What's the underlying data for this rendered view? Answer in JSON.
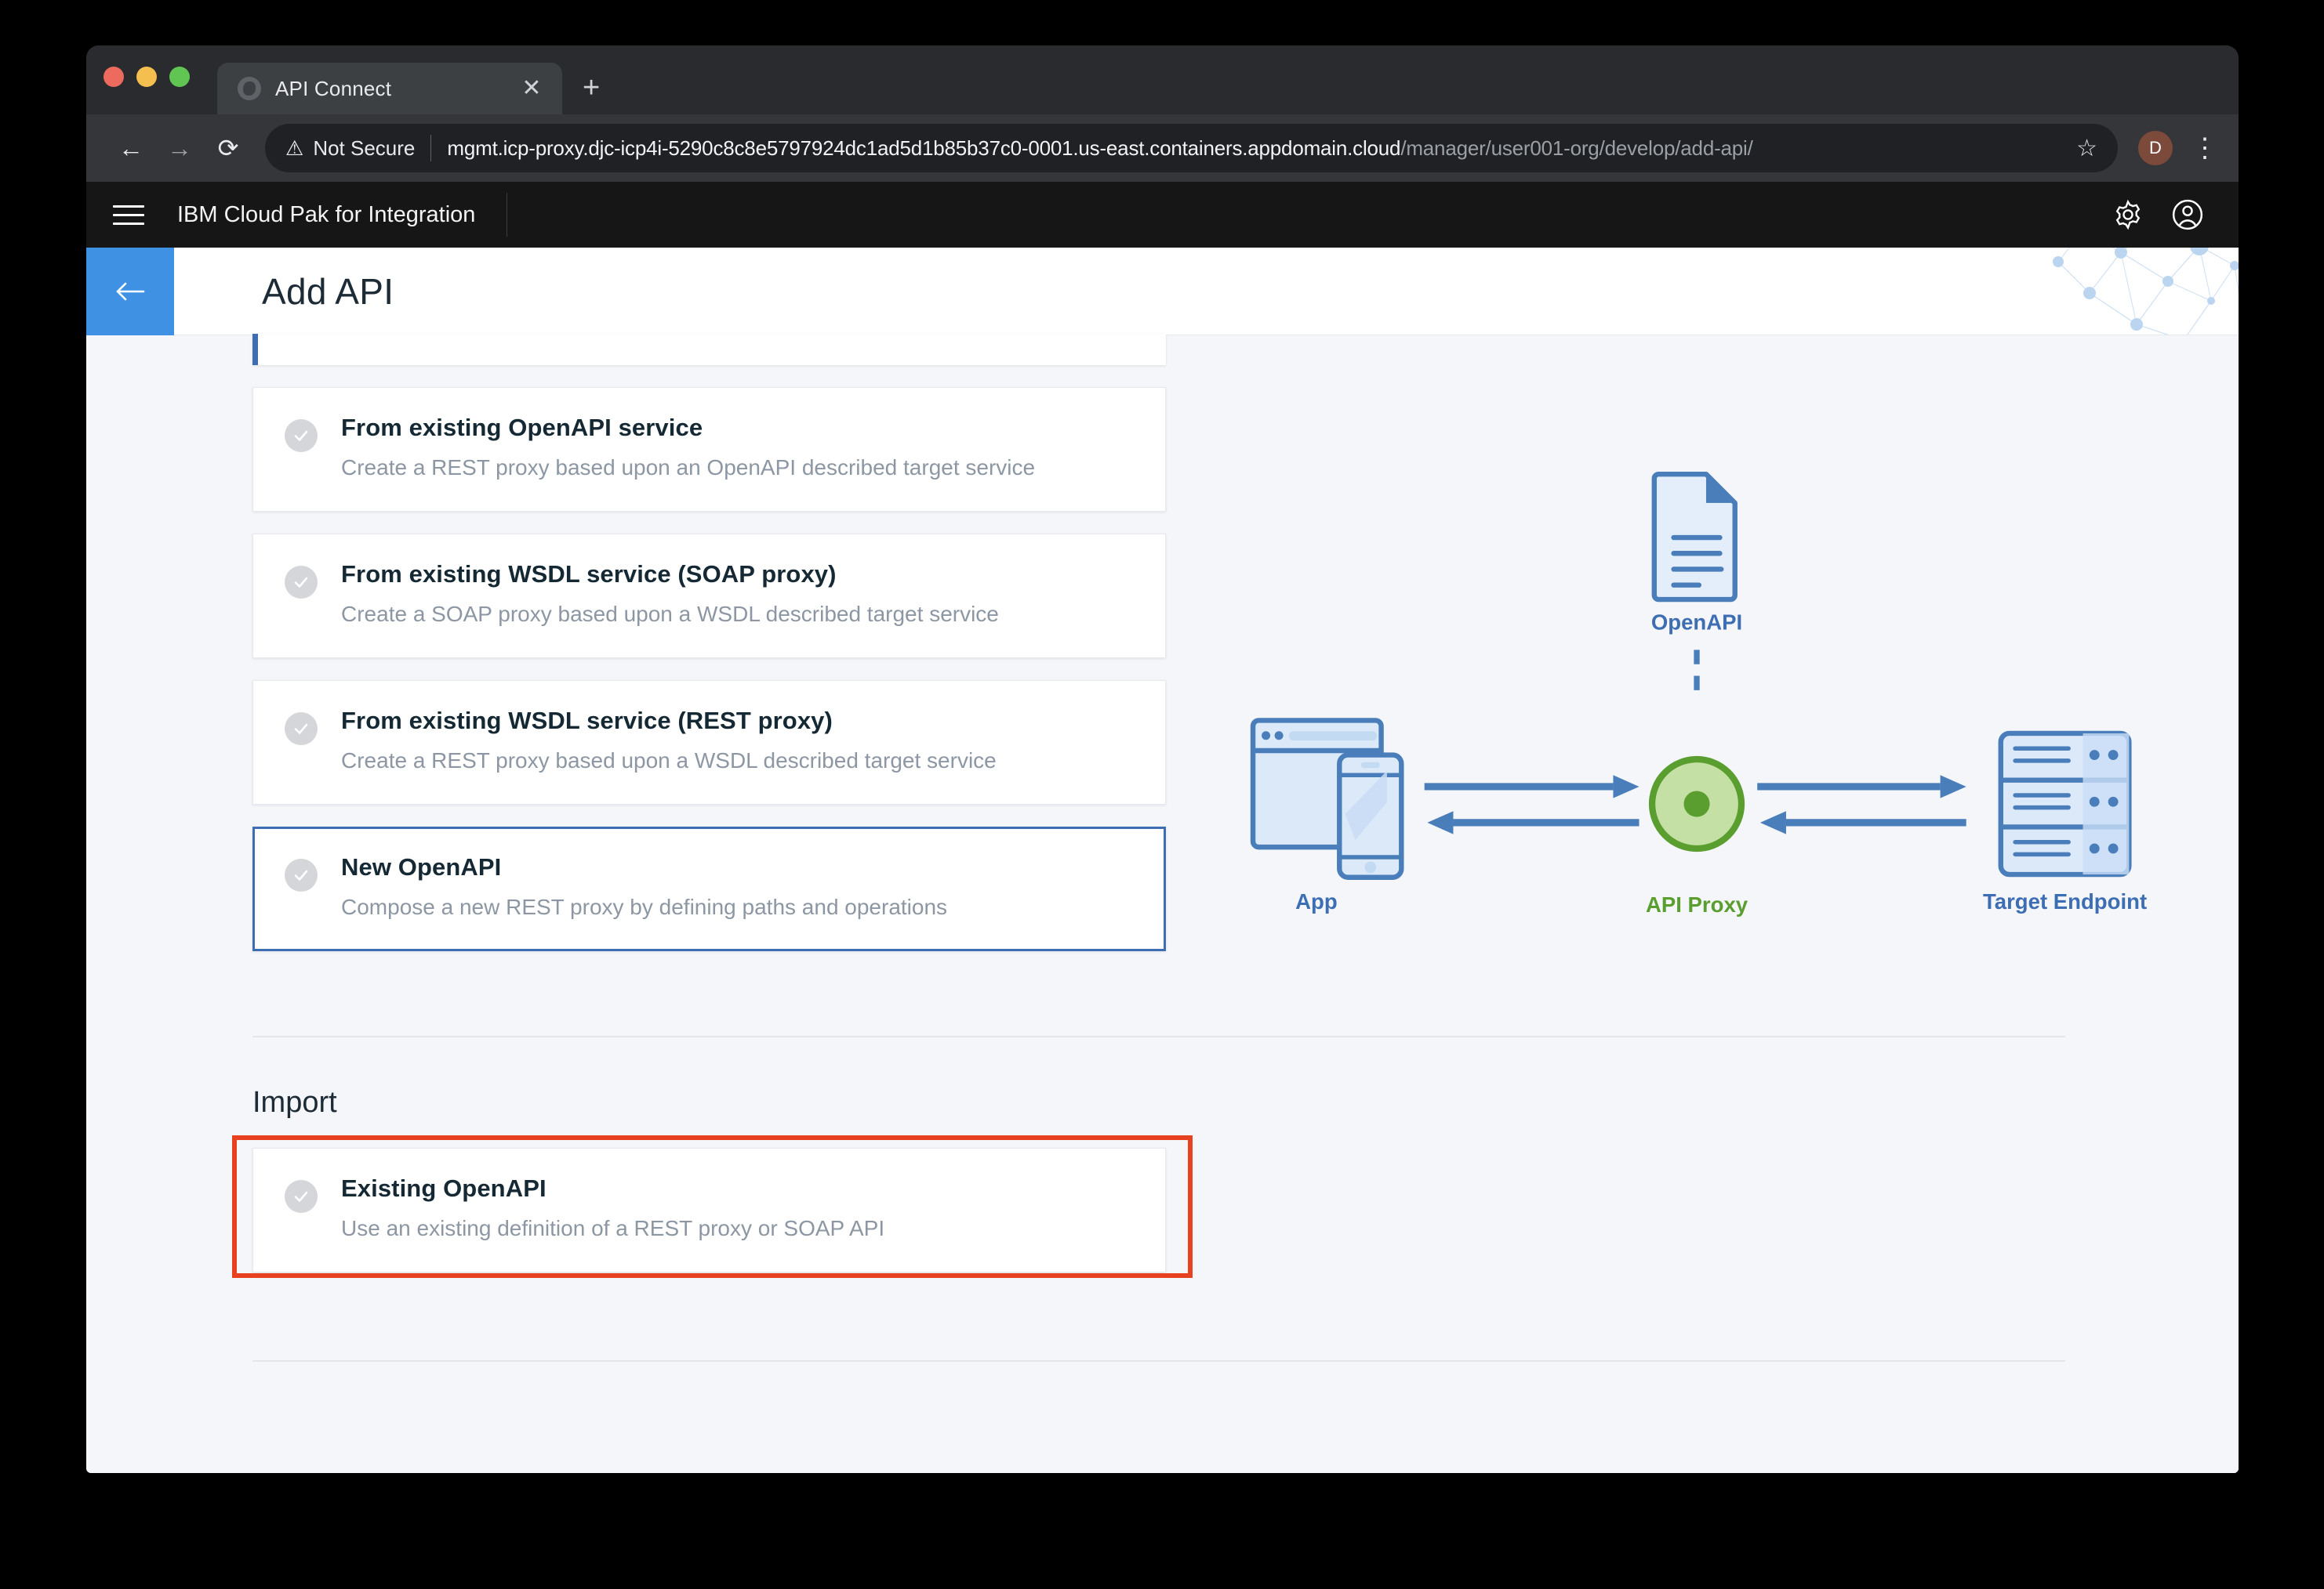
{
  "browser": {
    "tab": {
      "title": "API Connect",
      "favicon": "globe-icon",
      "close_label": "✕"
    },
    "new_tab_label": "+",
    "nav": {
      "back": "←",
      "forward": "→",
      "reload": "⟳"
    },
    "security_label": "Not Secure",
    "url_host": "mgmt.icp-proxy.djc-icp4i-5290c8c8e5797924dc1ad5d1b85b37c0-0001.us-east.containers.appdomain.cloud",
    "url_path": "/manager/user001-org/develop/add-api/",
    "bookmark_label": "☆",
    "profile_initial": "D",
    "menu_label": "⋮"
  },
  "app_header": {
    "menu_icon": "hamburger-menu-icon",
    "title": "IBM Cloud Pak for Integration",
    "settings_icon": "gear-icon",
    "account_icon": "user-account-icon"
  },
  "page": {
    "back_label": "←",
    "title": "Add API"
  },
  "options": [
    {
      "title": "From existing OpenAPI service",
      "desc": "Create a REST proxy based upon an OpenAPI described target service",
      "selected": false
    },
    {
      "title": "From existing WSDL service (SOAP proxy)",
      "desc": "Create a SOAP proxy based upon a WSDL described target service",
      "selected": false
    },
    {
      "title": "From existing WSDL service (REST proxy)",
      "desc": "Create a REST proxy based upon a WSDL described target service",
      "selected": false
    },
    {
      "title": "New OpenAPI",
      "desc": "Compose a new REST proxy by defining paths and operations",
      "selected": true
    }
  ],
  "import": {
    "section_title": "Import",
    "card": {
      "title": "Existing OpenAPI",
      "desc": "Use an existing definition of a REST proxy or SOAP API",
      "highlighted": true
    }
  },
  "diagram": {
    "openapi_label": "OpenAPI",
    "app_label": "App",
    "proxy_label": "API Proxy",
    "target_label": "Target Endpoint"
  },
  "colors": {
    "accent_blue": "#3f92e3",
    "selected_border": "#3d6eb4",
    "annotation_red": "#e8411f",
    "diagram_blue": "#4a7ebb",
    "diagram_green": "#5a9e2f",
    "page_bg": "#f4f6f9",
    "header_dark": "#161616"
  }
}
